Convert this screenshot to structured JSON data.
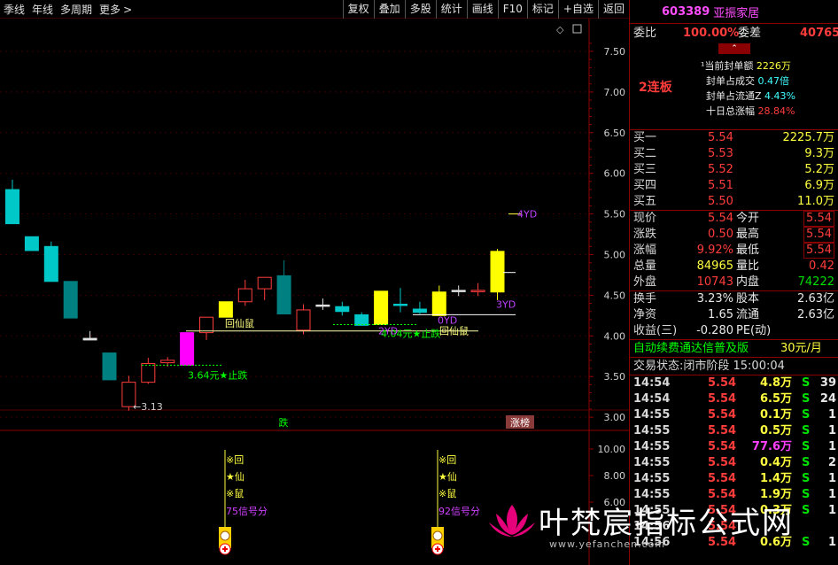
{
  "toolbar": {
    "left_items": [
      "季线",
      "年线",
      "多周期",
      "更多"
    ],
    "right_buttons": [
      "复权",
      "叠加",
      "多股",
      "统计",
      "画线",
      "F10",
      "标记",
      "+自选",
      "返回"
    ]
  },
  "colors": {
    "up": "#ff3c3c",
    "down": "#00c8c8",
    "down_dark": "#008080",
    "yellow": "#ffff00",
    "magenta": "#ff00ff",
    "green_text": "#00ff00"
  },
  "chart_data": {
    "type": "candlestick",
    "price_axis": [
      7.5,
      7.0,
      6.5,
      6.0,
      5.5,
      5.0,
      4.5,
      4.0,
      3.5,
      3.0
    ],
    "indicator_axis": [
      10.0,
      8.0,
      6.0
    ],
    "candles": [
      {
        "o": 5.8,
        "h": 5.92,
        "l": 5.38,
        "c": 5.38,
        "kind": "down"
      },
      {
        "o": 5.22,
        "h": 5.22,
        "l": 5.22,
        "c": 5.05,
        "kind": "down"
      },
      {
        "o": 5.1,
        "h": 5.16,
        "l": 4.69,
        "c": 4.67,
        "kind": "down"
      },
      {
        "o": 4.67,
        "h": 4.67,
        "l": 4.22,
        "c": 4.22,
        "kind": "downdark"
      },
      {
        "o": 3.95,
        "h": 4.06,
        "l": 3.97,
        "c": 3.97,
        "kind": "doji"
      },
      {
        "o": 3.79,
        "h": 3.79,
        "l": 3.46,
        "c": 3.46,
        "kind": "downdark"
      },
      {
        "o": 3.13,
        "h": 3.51,
        "l": 3.08,
        "c": 3.43,
        "kind": "up"
      },
      {
        "o": 3.43,
        "h": 3.73,
        "l": 3.41,
        "c": 3.66,
        "kind": "up"
      },
      {
        "o": 3.67,
        "h": 3.74,
        "l": 3.62,
        "c": 3.7,
        "kind": "up"
      },
      {
        "o": 3.64,
        "h": 4.04,
        "l": 3.64,
        "c": 4.04,
        "kind": "magenta"
      },
      {
        "o": 4.04,
        "h": 4.22,
        "l": 3.95,
        "c": 4.23,
        "kind": "up"
      },
      {
        "o": 4.23,
        "h": 4.42,
        "l": 4.23,
        "c": 4.42,
        "kind": "yellow"
      },
      {
        "o": 4.42,
        "h": 4.69,
        "l": 4.37,
        "c": 4.58,
        "kind": "up"
      },
      {
        "o": 4.58,
        "h": 4.71,
        "l": 4.44,
        "c": 4.72,
        "kind": "up"
      },
      {
        "o": 4.74,
        "h": 4.93,
        "l": 4.27,
        "c": 4.27,
        "kind": "downdark"
      },
      {
        "o": 4.07,
        "h": 4.39,
        "l": 4.02,
        "c": 4.32,
        "kind": "up"
      },
      {
        "o": 4.38,
        "h": 4.46,
        "l": 4.32,
        "c": 4.38,
        "kind": "doji"
      },
      {
        "o": 4.36,
        "h": 4.42,
        "l": 4.25,
        "c": 4.3,
        "kind": "down"
      },
      {
        "o": 4.26,
        "h": 4.29,
        "l": 4.13,
        "c": 4.13,
        "kind": "down"
      },
      {
        "o": 4.14,
        "h": 4.55,
        "l": 4.14,
        "c": 4.55,
        "kind": "yellow"
      },
      {
        "o": 4.39,
        "h": 4.59,
        "l": 4.29,
        "c": 4.39,
        "kind": "down"
      },
      {
        "o": 4.29,
        "h": 4.42,
        "l": 4.27,
        "c": 4.33,
        "kind": "down"
      },
      {
        "o": 4.25,
        "h": 4.62,
        "l": 4.25,
        "c": 4.54,
        "kind": "yellow"
      },
      {
        "o": 4.56,
        "h": 4.62,
        "l": 4.49,
        "c": 4.56,
        "kind": "doji"
      },
      {
        "o": 4.56,
        "h": 4.65,
        "l": 4.49,
        "c": 4.56,
        "kind": "up"
      },
      {
        "o": 4.54,
        "h": 5.07,
        "l": 4.44,
        "c": 5.04,
        "kind": "yellow"
      }
    ],
    "annotations": {
      "low_label": "3.13",
      "stop_label_1": "3.64元★止跌",
      "stop_label_2": "4.04元★止跌",
      "hxs_label_1": "回仙鼠",
      "hxs_label_2": "回仙鼠",
      "yd_label_1": "4YD",
      "yd_label_2": "3YD",
      "yd_label_3": "2YD",
      "yd_label_4": "0YD",
      "badge_die": "跌",
      "badge_zt": "涨榜"
    },
    "signals": [
      {
        "lines": [
          "※回",
          "★仙",
          "※鼠"
        ],
        "score": "75信号分"
      },
      {
        "lines": [
          "※回",
          "★仙",
          "※鼠"
        ],
        "score": "92信号分"
      }
    ]
  },
  "panel": {
    "code": "603389",
    "name": "亚振家居",
    "weibi_label": "委比",
    "weibi_value": "100.00%",
    "weicha_label": "委差",
    "weicha_value": "40765",
    "board": "2连板",
    "seal": [
      {
        "label": "当前封单额",
        "value": "2226万"
      },
      {
        "label": "封单占成交",
        "value": "0.47倍"
      },
      {
        "label": "封单占流通Z",
        "value": "4.43%"
      },
      {
        "label": "十日总涨幅",
        "value": "28.84%"
      }
    ],
    "bids": [
      {
        "label": "买一",
        "price": "5.54",
        "vol": "2225.7万"
      },
      {
        "label": "买二",
        "price": "5.53",
        "vol": "9.3万"
      },
      {
        "label": "买三",
        "price": "5.52",
        "vol": "5.2万"
      },
      {
        "label": "买四",
        "price": "5.51",
        "vol": "6.9万"
      },
      {
        "label": "买五",
        "price": "5.50",
        "vol": "11.0万"
      }
    ],
    "quote": [
      {
        "l1": "现价",
        "v1": "5.54",
        "l2": "今开",
        "v2": "5.54"
      },
      {
        "l1": "涨跌",
        "v1": "0.50",
        "l2": "最高",
        "v2": "5.54"
      },
      {
        "l1": "涨幅",
        "v1": "9.92%",
        "l2": "最低",
        "v2": "5.54"
      },
      {
        "l1": "总量",
        "v1": "84965",
        "l2": "量比",
        "v2": "0.42"
      },
      {
        "l1": "外盘",
        "v1": "10743",
        "l2": "内盘",
        "v2": "74222"
      }
    ],
    "stats": [
      {
        "l1": "换手",
        "v1": "3.23%",
        "l2": "股本",
        "v2": "2.63亿"
      },
      {
        "l1": "净资",
        "v1": "1.65",
        "l2": "流通",
        "v2": "2.63亿"
      },
      {
        "l1": "收益(三)",
        "v1": "-0.280",
        "l2": "PE(动)",
        "v2": ""
      }
    ],
    "promo": "自动续费通达信普及版",
    "promo_price": "30元/月",
    "status": "交易状态:闭市阶段 15:00:04",
    "ticks": [
      {
        "t": "14:54",
        "p": "5.54",
        "v": "4.8万",
        "s": "S",
        "n": "39"
      },
      {
        "t": "14:54",
        "p": "5.54",
        "v": "6.5万",
        "s": "S",
        "n": "24"
      },
      {
        "t": "14:55",
        "p": "5.54",
        "v": "0.1万",
        "s": "S",
        "n": "1"
      },
      {
        "t": "14:55",
        "p": "5.54",
        "v": "0.5万",
        "s": "S",
        "n": "1"
      },
      {
        "t": "14:55",
        "p": "5.54",
        "v": "77.6万",
        "s": "S",
        "n": "1"
      },
      {
        "t": "14:55",
        "p": "5.54",
        "v": "0.4万",
        "s": "S",
        "n": "2"
      },
      {
        "t": "14:55",
        "p": "5.54",
        "v": "1.4万",
        "s": "S",
        "n": "1"
      },
      {
        "t": "14:55",
        "p": "5.54",
        "v": "1.9万",
        "s": "S",
        "n": "1"
      },
      {
        "t": "14:55",
        "p": "5.54",
        "v": "0.3万",
        "s": "S",
        "n": "1"
      },
      {
        "t": "14:56",
        "p": "5.54",
        "v": "",
        "s": "",
        "n": ""
      },
      {
        "t": "14:56",
        "p": "5.54",
        "v": "0.6万",
        "s": "S",
        "n": "1"
      }
    ]
  },
  "watermark": {
    "text": "叶梵宸指标公式网",
    "url": "www.yefanchen.com"
  }
}
